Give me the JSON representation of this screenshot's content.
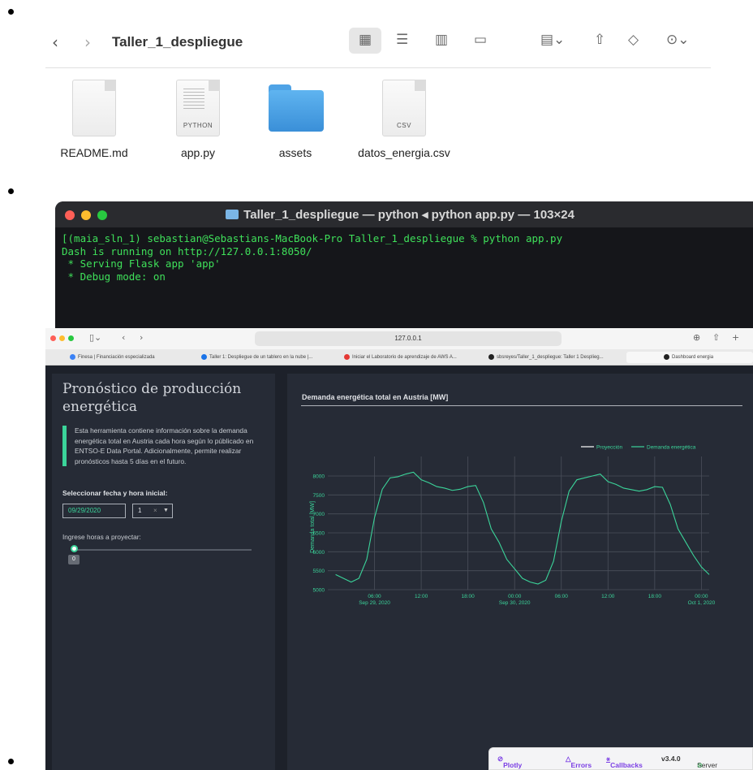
{
  "finder": {
    "title": "Taller_1_despliegue",
    "back_glyph": "‹",
    "forward_glyph": "›",
    "toolbar_icons": [
      "grid-view-icon",
      "list-view-icon",
      "column-view-icon",
      "gallery-view-icon",
      "group-icon",
      "share-icon",
      "tag-icon",
      "more-icon"
    ],
    "files": [
      {
        "name": "README.md",
        "kind": "document",
        "tag": ""
      },
      {
        "name": "app.py",
        "kind": "document",
        "tag": "PYTHON"
      },
      {
        "name": "assets",
        "kind": "folder",
        "tag": ""
      },
      {
        "name": "datos_energia.csv",
        "kind": "document",
        "tag": "CSV"
      }
    ]
  },
  "terminal": {
    "title": "Taller_1_despliegue — python ◂ python app.py — 103×24",
    "lines": [
      "[(maia_sln_1) sebastian@Sebastians-MacBook-Pro Taller_1_despliegue % python app.py",
      "Dash is running on http://127.0.0.1:8050/",
      "",
      " * Serving Flask app 'app'",
      " * Debug mode: on"
    ]
  },
  "browser": {
    "url": "127.0.0.1",
    "tabs": [
      {
        "label": "Finesa | Financiación especializada",
        "color": "#3b82f6"
      },
      {
        "label": "Taller 1: Despliegue de un tablero en la nube |...",
        "color": "#1a73e8"
      },
      {
        "label": "Iniciar el Laboratorio de aprendizaje de AWS A...",
        "color": "#e53935"
      },
      {
        "label": "sbsreyes/Taller_1_despliegue: Taller 1 Desplieg...",
        "color": "#222222"
      },
      {
        "label": "Dashboard energia",
        "color": "#222222"
      }
    ]
  },
  "app": {
    "title": "Pronóstico de producción energética",
    "description": "Esta herramienta contiene información sobre la demanda energética total en Austria cada hora según lo públicado en ENTSO-E Data Portal. Adicionalmente, permite realizar pronósticos hasta 5 días en el futuro.",
    "date_label": "Seleccionar fecha y hora inicial:",
    "date_value": "09/29/2020",
    "hour_value": "1",
    "hour_clear": "×",
    "hours_label": "Ingrese horas a proyectar:",
    "slider_value": "0",
    "accent": "#3bd49a"
  },
  "chart_data": {
    "type": "line",
    "title": "Demanda energética total en Austria [MW]",
    "xlabel": "",
    "ylabel": "Demanda total [MW]",
    "ylim": [
      5000,
      8300
    ],
    "yticks": [
      "5000",
      "5500",
      "6000",
      "6500",
      "7000",
      "7500",
      "8000"
    ],
    "xticks": [
      {
        "l1": "06:00",
        "l2": "Sep 29, 2020"
      },
      {
        "l1": "12:00",
        "l2": ""
      },
      {
        "l1": "18:00",
        "l2": ""
      },
      {
        "l1": "00:00",
        "l2": "Sep 30, 2020"
      },
      {
        "l1": "06:00",
        "l2": ""
      },
      {
        "l1": "12:00",
        "l2": ""
      },
      {
        "l1": "18:00",
        "l2": ""
      },
      {
        "l1": "00:00",
        "l2": "Oct 1, 2020"
      }
    ],
    "legend_position": "top-right",
    "series": [
      {
        "name": "Proyección",
        "color": "#ffffff",
        "values": []
      },
      {
        "name": "Demanda energética",
        "color": "#3bd49a",
        "x_hours": [
          1,
          2,
          3,
          4,
          5,
          6,
          7,
          8,
          9,
          10,
          11,
          12,
          13,
          14,
          15,
          16,
          17,
          18,
          19,
          20,
          21,
          22,
          23,
          24,
          25,
          26,
          27,
          28,
          29,
          30,
          31,
          32,
          33,
          34,
          35,
          36,
          37,
          38,
          39,
          40,
          41,
          42,
          43,
          44,
          45,
          46,
          47,
          48,
          49
        ],
        "values": [
          5400,
          5300,
          5200,
          5300,
          5800,
          6900,
          7650,
          7950,
          7980,
          8050,
          8100,
          7900,
          7820,
          7720,
          7680,
          7620,
          7650,
          7720,
          7750,
          7300,
          6600,
          6250,
          5800,
          5550,
          5300,
          5200,
          5150,
          5250,
          5750,
          6800,
          7600,
          7900,
          7950,
          8000,
          8050,
          7850,
          7780,
          7680,
          7640,
          7600,
          7640,
          7720,
          7700,
          7250,
          6600,
          6250,
          5900,
          5600,
          5400
        ]
      }
    ]
  },
  "devbar": {
    "plotly_cloud": "Plotly Cloud",
    "errors": "Errors",
    "callbacks": "Callbacks",
    "version": "v3.4.0",
    "server": "Server"
  }
}
